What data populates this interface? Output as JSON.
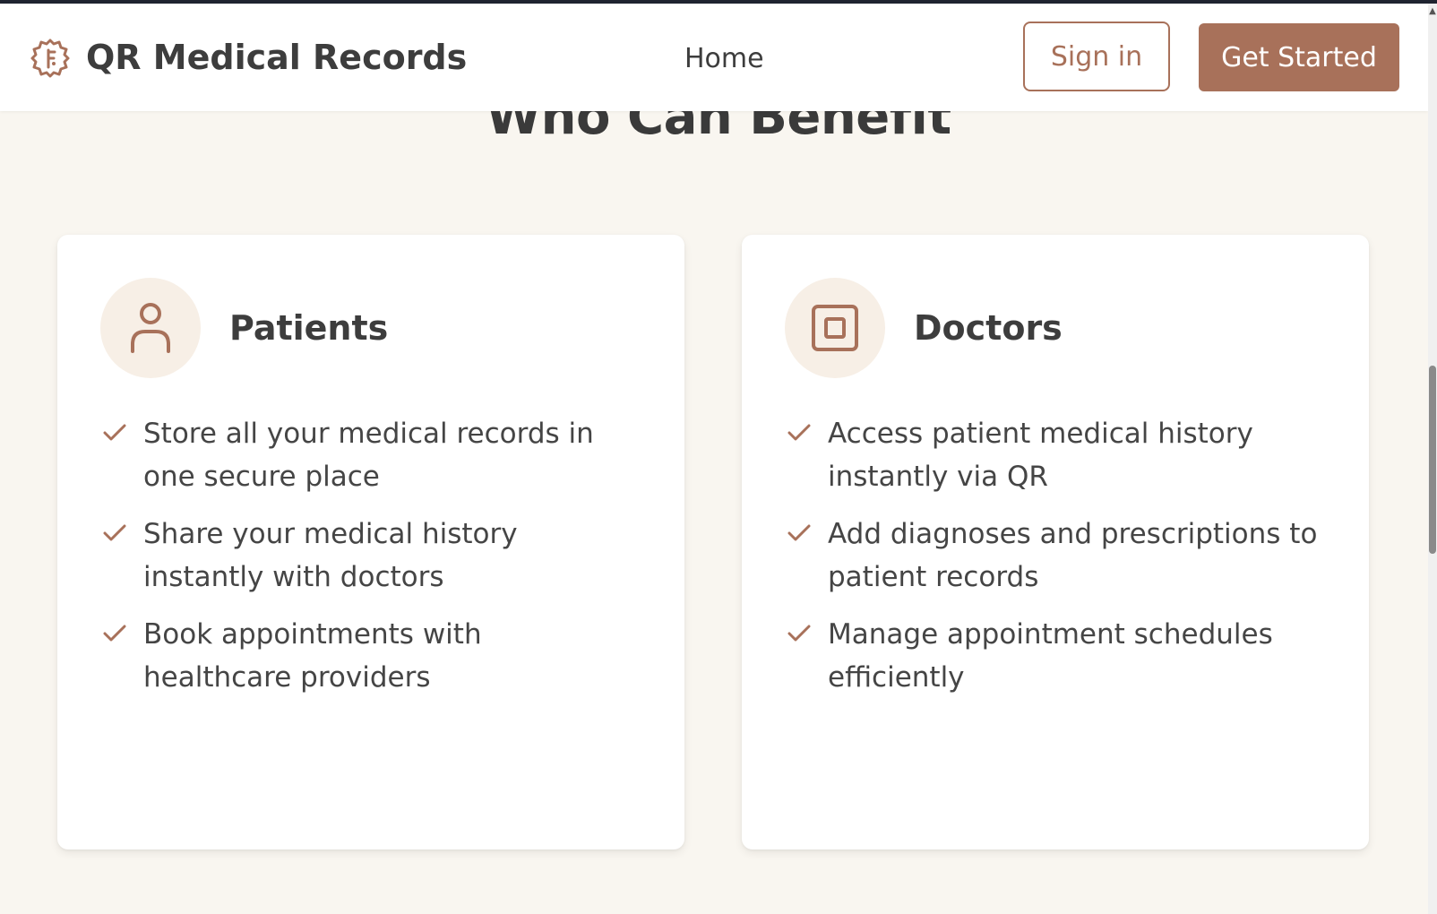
{
  "nav": {
    "brand": "QR Medical Records",
    "home_link": "Home",
    "signin_button": "Sign in",
    "get_started_button": "Get Started"
  },
  "section": {
    "title": "Who Can Benefit"
  },
  "cards": [
    {
      "title": "Patients",
      "icon": "user-icon",
      "features": [
        "Store all your medical records in one secure place",
        "Share your medical history instantly with doctors",
        "Book appointments with healthcare providers"
      ]
    },
    {
      "title": "Doctors",
      "icon": "stethoscope-box-icon",
      "features": [
        "Access patient medical history instantly via QR",
        "Add diagnoses and prescriptions to patient records",
        "Manage appointment schedules efficiently"
      ]
    }
  ],
  "colors": {
    "accent": "#a8715a",
    "background": "#f9f6f0",
    "card": "#ffffff",
    "icon_bg": "#f7efe6",
    "text": "#3d3d3d"
  }
}
